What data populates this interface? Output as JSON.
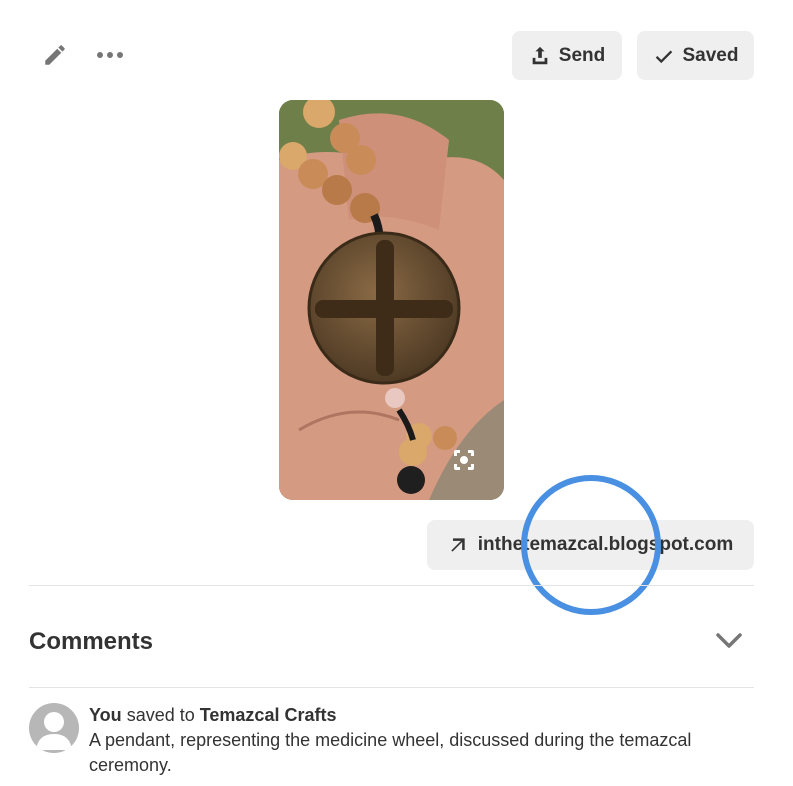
{
  "toolbar": {
    "edit_icon": "pencil-icon",
    "more_icon": "ellipsis-icon",
    "send_label": "Send",
    "saved_label": "Saved"
  },
  "pin": {
    "image_icon": "visual-search-icon"
  },
  "source_link": {
    "label": "inthetemazcal.blogspot.com",
    "icon": "arrow-up-right-icon"
  },
  "comments": {
    "title": "Comments",
    "toggle_icon": "chevron-down-icon"
  },
  "activity": {
    "actor": "You",
    "verb": "saved to",
    "board": "Temazcal Crafts",
    "description": "A pendant, representing the medicine wheel, discussed during the temazcal ceremony."
  },
  "colors": {
    "button_bg": "#efefef",
    "text": "#333333",
    "focus_ring": "#4a90e2"
  }
}
